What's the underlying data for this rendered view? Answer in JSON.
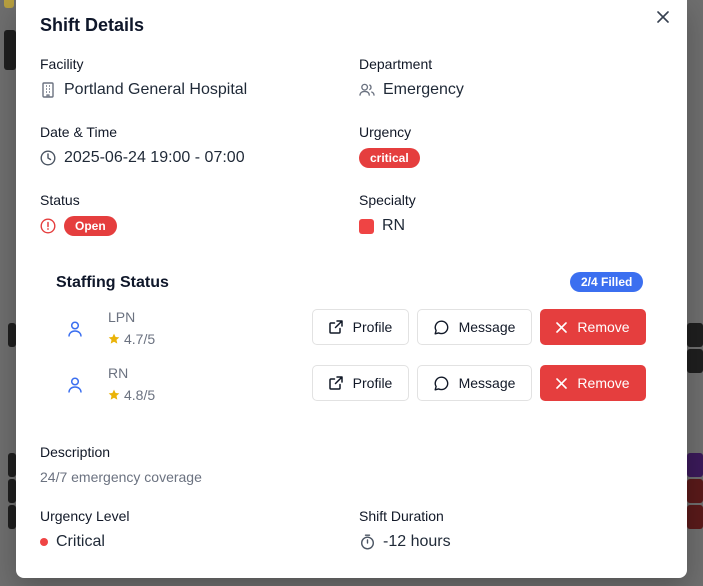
{
  "modal": {
    "title": "Shift Details"
  },
  "fields": {
    "facility": {
      "label": "Facility",
      "value": "Portland General Hospital"
    },
    "department": {
      "label": "Department",
      "value": "Emergency"
    },
    "datetime": {
      "label": "Date & Time",
      "value": "2025-06-24 19:00 - 07:00"
    },
    "urgency": {
      "label": "Urgency",
      "value": "critical"
    },
    "status": {
      "label": "Status",
      "value": "Open"
    },
    "specialty": {
      "label": "Specialty",
      "value": "RN"
    }
  },
  "staffing": {
    "title": "Staffing Status",
    "filled_badge": "2/4 Filled",
    "members": [
      {
        "role": "LPN",
        "rating": "4.7/5"
      },
      {
        "role": "RN",
        "rating": "4.8/5"
      }
    ],
    "buttons": {
      "profile": "Profile",
      "message": "Message",
      "remove": "Remove"
    }
  },
  "description": {
    "label": "Description",
    "text": "24/7 emergency coverage"
  },
  "urgency_level": {
    "label": "Urgency Level",
    "value": "Critical"
  },
  "shift_duration": {
    "label": "Shift Duration",
    "value": "-12 hours"
  },
  "colors": {
    "danger": "#e53e3e",
    "primary_badge": "#3b6ff0",
    "person_icon": "#3b6ff0",
    "star": "#eab308"
  },
  "icons": {
    "facility": "building-icon",
    "department": "users-icon",
    "datetime": "clock-icon",
    "status": "alert-circle-icon",
    "duration": "timer-icon",
    "person": "user-icon",
    "profile": "external-link-icon",
    "message": "message-circle-icon",
    "remove": "x-icon",
    "close": "close-icon"
  }
}
